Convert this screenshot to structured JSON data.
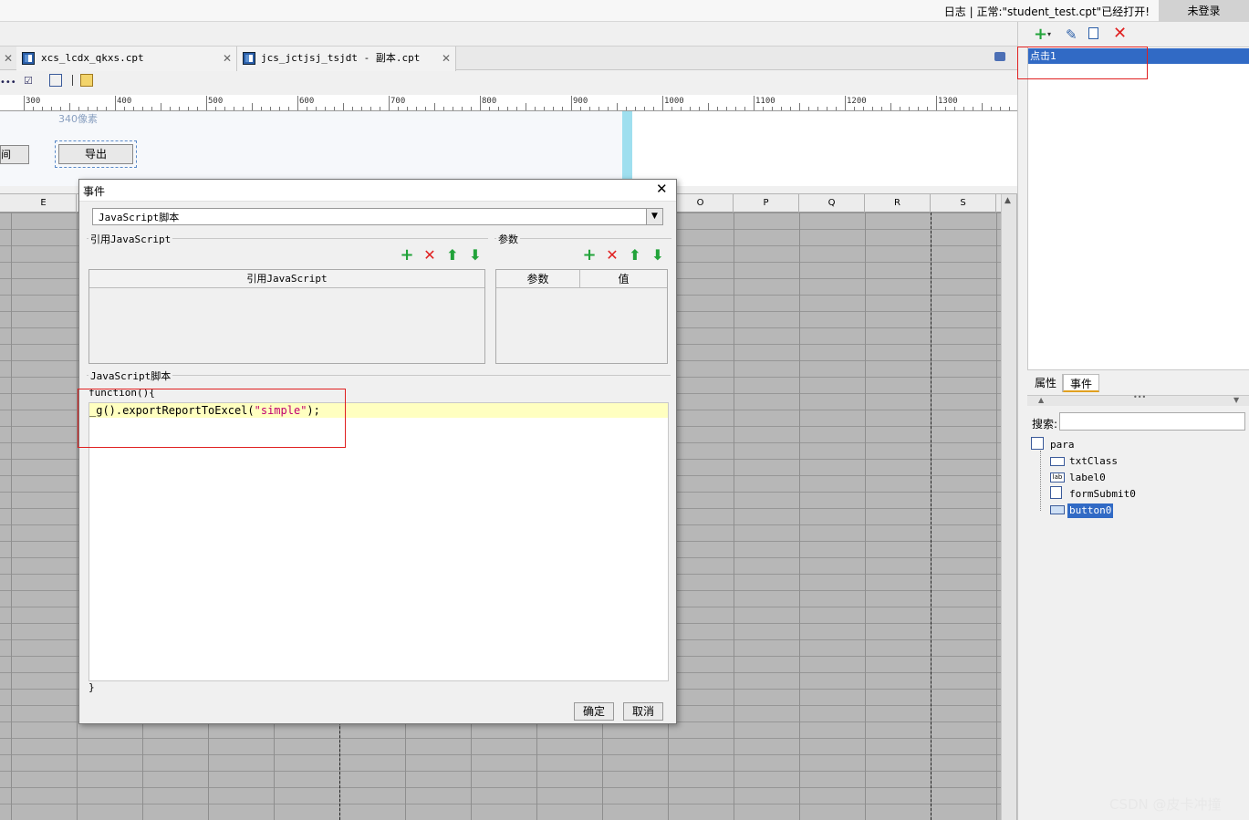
{
  "status_bar": {
    "text": "日志 | 正常:\"student_test.cpt\"已经打开!",
    "login": "未登录"
  },
  "tabs": [
    {
      "label": "xcs_lcdx_qkxs.cpt"
    },
    {
      "label": "jcs_jctjsj_tsjdt - 副本.cpt"
    }
  ],
  "ruler": {
    "labels": [
      "300",
      "400",
      "500",
      "600",
      "700",
      "800",
      "900",
      "1000",
      "1100",
      "1200",
      "1300"
    ]
  },
  "canvas": {
    "size_label": "340像素",
    "button_left_label": "间",
    "button_label": "导出"
  },
  "sheet": {
    "columns": [
      "E",
      "O",
      "P",
      "Q",
      "R",
      "S"
    ]
  },
  "dialog": {
    "title": "事件",
    "type_select": "JavaScript脚本",
    "ref_section": "引用JavaScript",
    "ref_table_header": "引用JavaScript",
    "params_section": "参数",
    "params_headers": [
      "参数",
      "值"
    ],
    "script_section": "JavaScript脚本",
    "code_open": "function(){",
    "code_body_prefix": "_g().exportReportToExcel(",
    "code_body_string": "\"simple\"",
    "code_body_suffix": ");",
    "code_close": "}",
    "ok": "确定",
    "cancel": "取消"
  },
  "right_panel": {
    "event_item": "点击1",
    "tabs": [
      "属性",
      "事件"
    ],
    "search_label": "搜索:",
    "search_value": "",
    "tree": [
      "para",
      "txtClass",
      "label0",
      "formSubmit0",
      "button0"
    ]
  },
  "watermark": "CSDN @皮卡冲撞",
  "colors": {
    "accent": "#316ac5",
    "highlight": "#ffffc0",
    "red": "#e02020",
    "green": "#22a33a"
  }
}
